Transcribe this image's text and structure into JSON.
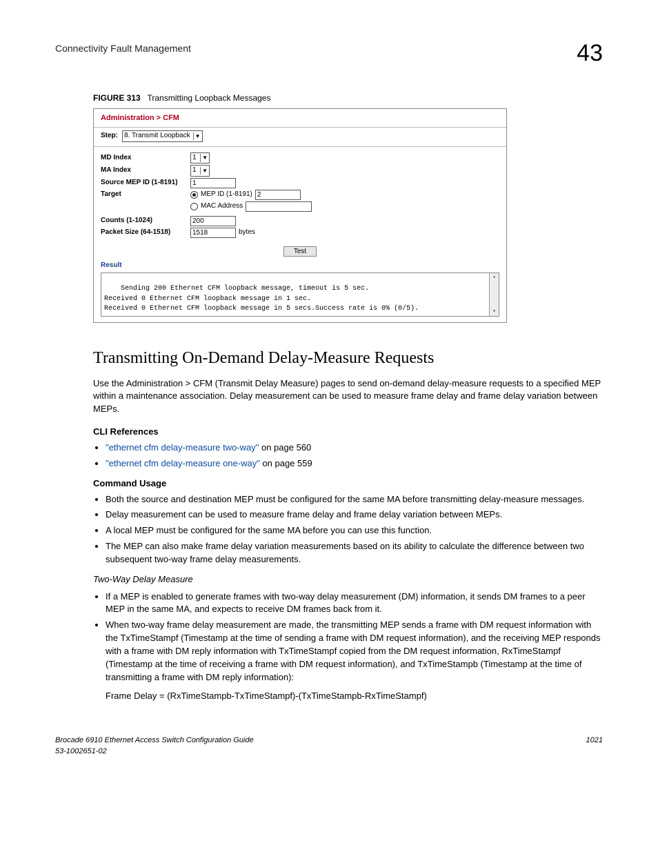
{
  "header": {
    "left": "Connectivity Fault Management",
    "right": "43"
  },
  "figure": {
    "label": "FIGURE 313",
    "title": "Transmitting Loopback Messages"
  },
  "screenshot": {
    "breadcrumb": "Administration > CFM",
    "step_label": "Step:",
    "step_value": "8. Transmit Loopback",
    "rows": {
      "md_index": {
        "label": "MD Index",
        "value": "1"
      },
      "ma_index": {
        "label": "MA Index",
        "value": "1"
      },
      "source_mep": {
        "label": "Source MEP ID (1-8191)",
        "value": "1"
      },
      "target": {
        "label": "Target",
        "opt1_label": "MEP ID (1-8191)",
        "opt1_value": "2",
        "opt2_label": "MAC Address",
        "opt2_value": ""
      },
      "counts": {
        "label": "Counts (1-1024)",
        "value": "200"
      },
      "packet_size": {
        "label": "Packet Size (64-1518)",
        "value": "1518",
        "unit": "bytes"
      }
    },
    "test_button": "Test",
    "result_label": "Result",
    "result_text": "Sending 200 Ethernet CFM loopback message, timeout is 5 sec.\nReceived 0 Ethernet CFM loopback message in 1 sec.\nReceived 0 Ethernet CFM loopback message in 5 secs.Success rate is 0% (0/5)."
  },
  "section": {
    "title": "Transmitting On-Demand Delay-Measure Requests",
    "intro": "Use the Administration > CFM (Transmit Delay Measure) pages to send on-demand delay-measure requests to a specified MEP within a maintenance association. Delay measurement can be used to measure frame delay and frame delay variation between MEPs.",
    "cli_head": "CLI References",
    "cli": [
      {
        "link": "\"ethernet cfm delay-measure two-way\"",
        "rest": " on page 560"
      },
      {
        "link": "\"ethernet cfm delay-measure one-way\"",
        "rest": " on page 559"
      }
    ],
    "usage_head": "Command Usage",
    "usage": [
      "Both the source and destination MEP must be configured for the same MA before transmitting delay-measure messages.",
      "Delay measurement can be used to measure frame delay and frame delay variation between MEPs.",
      "A local MEP must be configured for the same MA before you can use this function.",
      "The MEP can also make frame delay variation measurements based on its ability to calculate the difference between two subsequent two-way frame delay measurements."
    ],
    "twoway_head": "Two-Way Delay Measure",
    "twoway": [
      "If a MEP is enabled to generate frames with two-way delay measurement (DM) information, it sends DM frames to a peer MEP in the same MA, and expects to receive DM frames back from it.",
      "When two-way frame delay measurement are made, the transmitting MEP sends a frame with DM request information with the TxTimeStampf (Timestamp at the time of sending a frame with DM request information), and the receiving MEP responds with a frame with DM reply information with TxTimeStampf copied from the DM request information, RxTimeStampf (Timestamp at the time of receiving a frame with DM request information), and TxTimeStampb (Timestamp at the time of transmitting a frame with DM reply information):"
    ],
    "formula": "Frame Delay = (RxTimeStampb-TxTimeStampf)-(TxTimeStampb-RxTimeStampf)"
  },
  "footer": {
    "left1": "Brocade 6910 Ethernet Access Switch Configuration Guide",
    "left2": "53-1002651-02",
    "right": "1021"
  }
}
